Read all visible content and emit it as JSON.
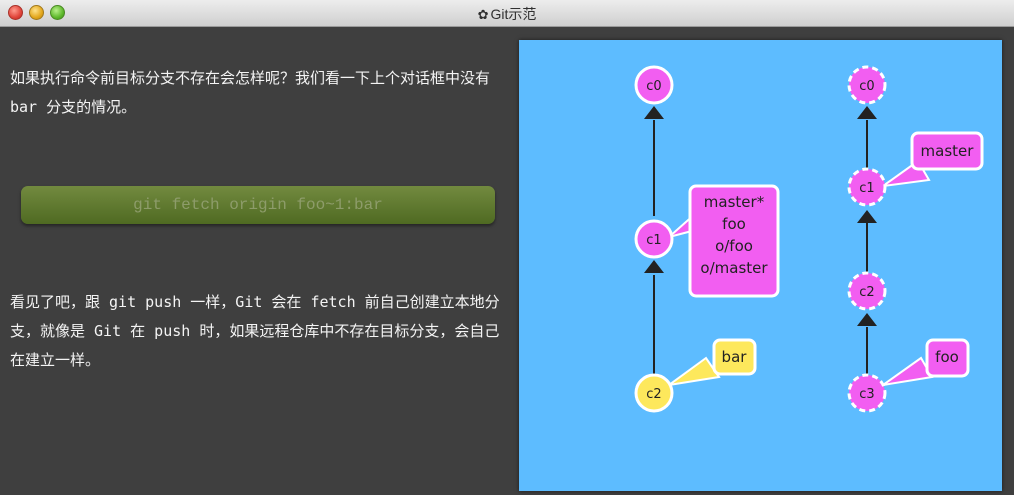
{
  "window": {
    "title": "Git示范",
    "title_icon": "gear-icon"
  },
  "lesson": {
    "paragraph1": "如果执行命令前目标分支不存在会怎样呢？我们看一下上个对话框中没有 bar 分支的情况。",
    "command": "git fetch origin foo~1:bar",
    "paragraph2": "看见了吧，跟 git push 一样，Git 会在 fetch 前自己创建立本地分支，就像是 Git 在 push 时，如果远程仓库中不存在目标分支，会自己在建立一样。"
  },
  "graph": {
    "background": "#5dbcff",
    "local": {
      "commits": [
        "c0",
        "c1",
        "c2"
      ],
      "label_c1": [
        "master*",
        "foo",
        "o/foo",
        "o/master"
      ],
      "label_c2": "bar"
    },
    "remote": {
      "commits": [
        "c0",
        "c1",
        "c2",
        "c3"
      ],
      "label_master": "master",
      "label_foo": "foo"
    },
    "colors": {
      "commit_pink": "#f25ef1",
      "commit_yellow": "#fde85c",
      "branch_pink": "#f25ef1",
      "branch_yellow": "#fde85c"
    }
  }
}
